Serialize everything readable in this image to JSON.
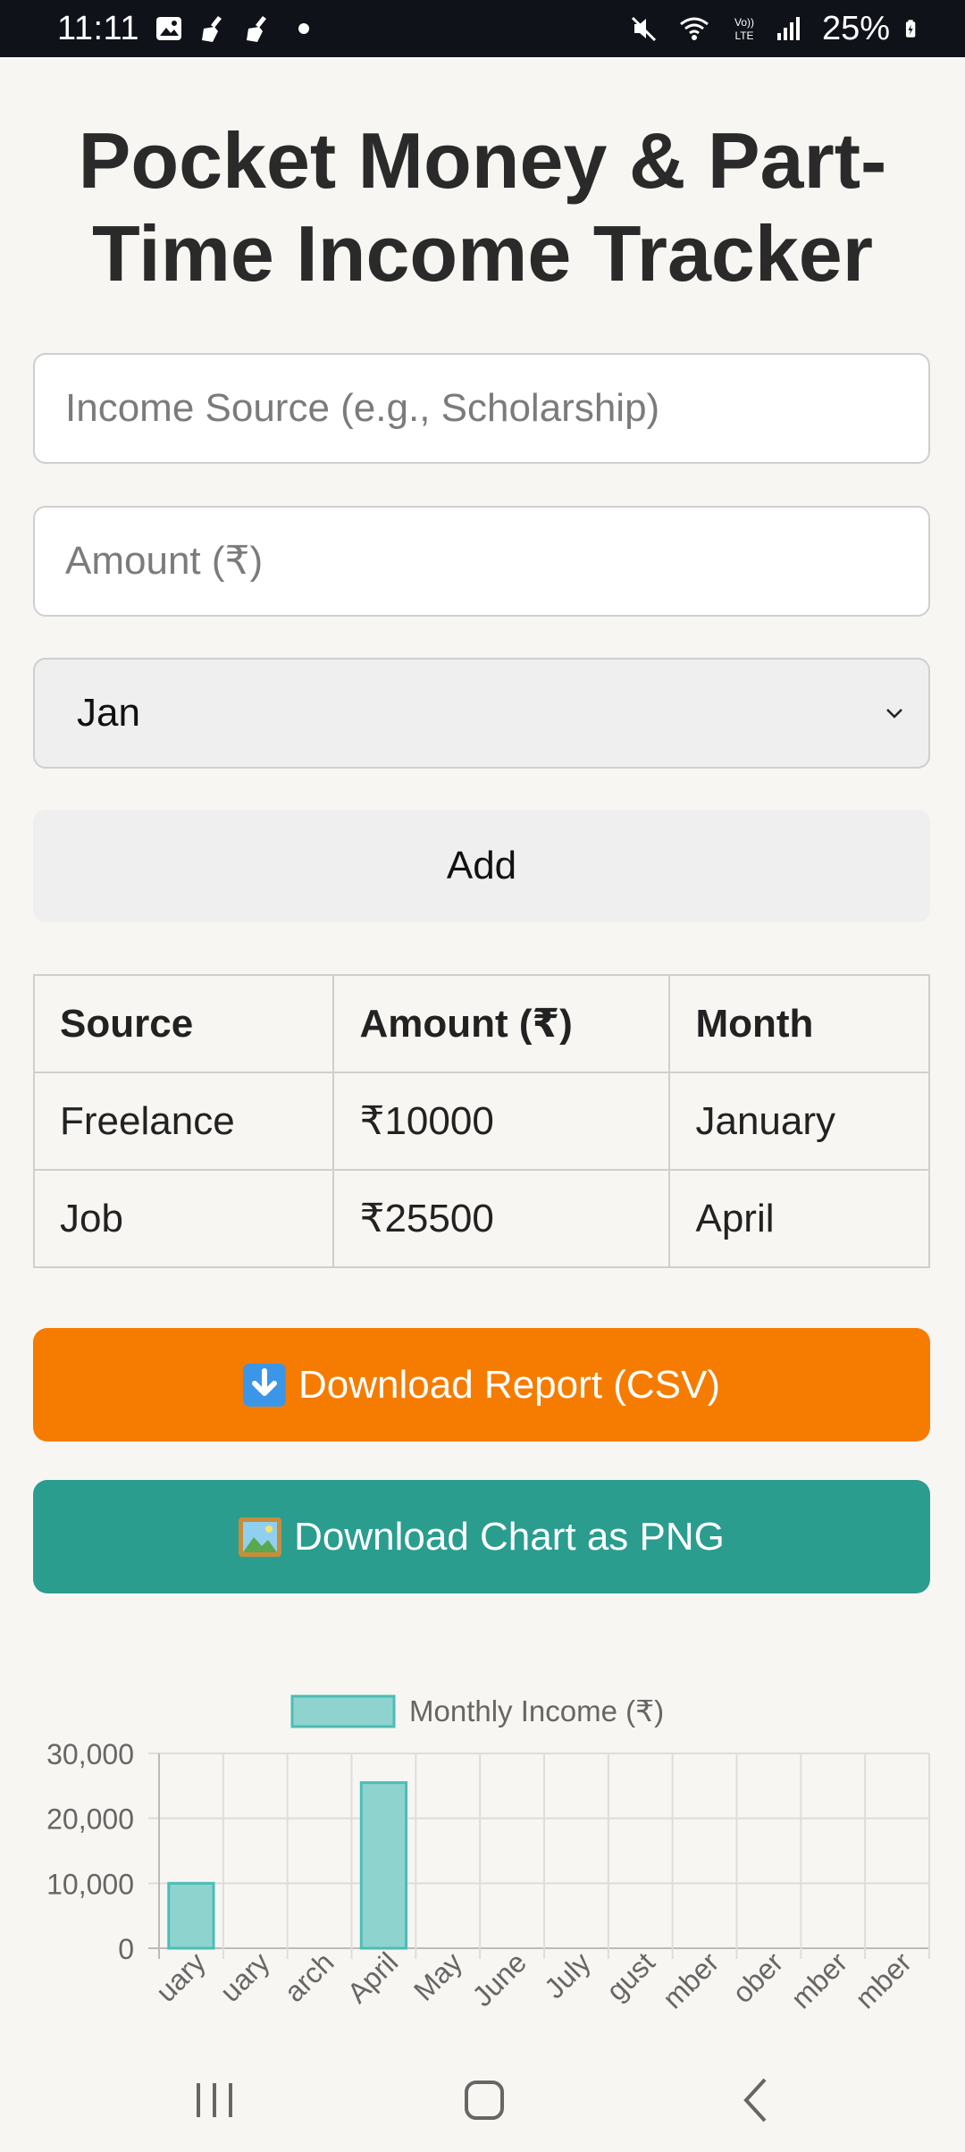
{
  "status_bar": {
    "time": "11:11",
    "battery": "25%",
    "icons": [
      "gallery-icon",
      "broom-icon",
      "broom-icon",
      "dot-icon",
      "mute-icon",
      "wifi-icon",
      "volte-icon",
      "signal-icon",
      "battery-icon"
    ]
  },
  "page": {
    "title": "Pocket Money & Part-Time Income Tracker"
  },
  "form": {
    "source_placeholder": "Income Source (e.g., Scholarship)",
    "amount_placeholder": "Amount (₹)",
    "month_selected": "Jan",
    "add_label": "Add"
  },
  "table": {
    "headers": [
      "Source",
      "Amount (₹)",
      "Month"
    ],
    "rows": [
      [
        "Freelance",
        "₹10000",
        "January"
      ],
      [
        "Job",
        "₹25500",
        "April"
      ]
    ]
  },
  "actions": {
    "csv_label": "Download Report (CSV)",
    "png_label": "Download Chart as PNG",
    "csv_icon": "download-arrow-icon",
    "png_icon": "framed-picture-icon",
    "csv_color": "#f57c00",
    "png_color": "#2a9d8f"
  },
  "chart_data": {
    "type": "bar",
    "legend": "Monthly Income (₹)",
    "categories": [
      "January",
      "February",
      "March",
      "April",
      "May",
      "June",
      "July",
      "August",
      "September",
      "October",
      "November",
      "December"
    ],
    "visible_tick_labels": [
      "uary",
      "uary",
      "arch",
      "April",
      "May",
      "June",
      "July",
      "gust",
      "mber",
      "ober",
      "mber",
      "mber"
    ],
    "values": [
      10000,
      0,
      0,
      25500,
      0,
      0,
      0,
      0,
      0,
      0,
      0,
      0
    ],
    "yticks": [
      "0",
      "10,000",
      "20,000",
      "30,000"
    ],
    "ylim": [
      0,
      30000
    ],
    "grid": true,
    "legend_position": "top",
    "bar_fill": "#8fd3cf",
    "bar_stroke": "#4bbdb6"
  }
}
